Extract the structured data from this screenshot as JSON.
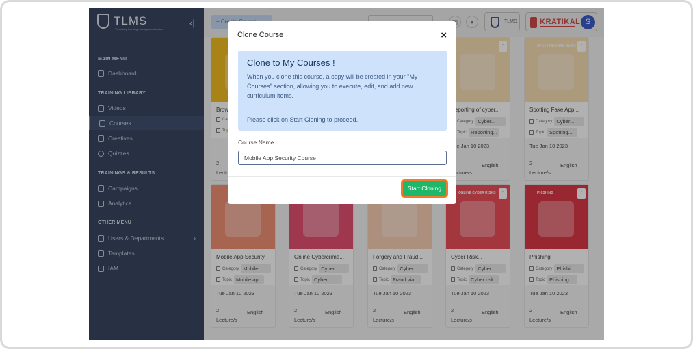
{
  "app": {
    "logo_text": "TLMS",
    "logo_sub": "Threatcop learning management system"
  },
  "sidebar": {
    "sections": [
      {
        "heading": "MAIN MENU",
        "items": [
          {
            "label": "Dashboard",
            "icon": "home-icon"
          }
        ]
      },
      {
        "heading": "TRAINING LIBRARY",
        "items": [
          {
            "label": "Videos",
            "icon": "video-icon"
          },
          {
            "label": "Courses",
            "icon": "book-icon",
            "active": true
          },
          {
            "label": "Creatives",
            "icon": "image-icon"
          },
          {
            "label": "Quizzes",
            "icon": "help-circle-icon"
          }
        ]
      },
      {
        "heading": "TRAININGS & RESULTS",
        "items": [
          {
            "label": "Campaigns",
            "icon": "megaphone-icon"
          },
          {
            "label": "Analytics",
            "icon": "chart-icon"
          }
        ]
      },
      {
        "heading": "OTHER MENU",
        "items": [
          {
            "label": "Users & Departments",
            "icon": "users-icon"
          },
          {
            "label": "Templates",
            "icon": "megaphone-icon"
          },
          {
            "label": "IAM",
            "icon": "key-icon"
          }
        ]
      }
    ]
  },
  "topbar": {
    "create_label": "+ Create Course",
    "tlms_label": "TLMS",
    "brand": "KRATIKAL",
    "avatar_initial": "S"
  },
  "cards": [
    {
      "title": "Brow...",
      "category": "",
      "topic": "",
      "date": "",
      "lectures": "2",
      "lectures_unit": "Lecture/s",
      "language": "",
      "color": "#f0b400"
    },
    {
      "title": "Reporting of cyber...",
      "category": "Cyber...",
      "topic": "Reporting...",
      "date": "Tue Jan 10 2023",
      "lectures": "2",
      "lectures_unit": "Lecture/s",
      "language": "English",
      "color": "#f7d9a8"
    },
    {
      "title": "Spotting Fake App...",
      "category": "Cyber...",
      "topic": "Spotting...",
      "date": "Tue Jan 10 2023",
      "lectures": "2",
      "lectures_unit": "Lecture/s",
      "language": "English",
      "color": "#f7d9a8",
      "tag": "SPOTTING FAKE NEWS"
    },
    {
      "title": "Mobile App Security",
      "category": "Mobile...",
      "topic": "Mobile ap...",
      "date": "Tue Jan 10 2023",
      "lectures": "2",
      "lectures_unit": "Lecture/s",
      "language": "English",
      "color": "#ef7f60"
    },
    {
      "title": "Online Cybercrime...",
      "category": "Cyber...",
      "topic": "Cyber...",
      "date": "Tue Jan 10 2023",
      "lectures": "2",
      "lectures_unit": "Lecture/s",
      "language": "English",
      "color": "#e2365b"
    },
    {
      "title": "Forgery and Fraud...",
      "category": "Cyber...",
      "topic": "Fraud via...",
      "date": "Tue Jan 10 2023",
      "lectures": "2",
      "lectures_unit": "Lecture/s",
      "language": "English",
      "color": "#f7c8a8"
    },
    {
      "title": "Cyber Risk...",
      "category": "Cyber...",
      "topic": "Cyber risk...",
      "date": "Tue Jan 10 2023",
      "lectures": "2",
      "lectures_unit": "Lecture/s",
      "language": "English",
      "color": "#e8353f",
      "tag": "ONLINE CYBER RISKS"
    },
    {
      "title": "Phishing",
      "category": "Phishi...",
      "topic": "Phishing",
      "date": "Tue Jan 10 2023",
      "lectures": "2",
      "lectures_unit": "Lecture/s",
      "language": "English",
      "color": "#d7192a",
      "tag": "PHISHING"
    }
  ],
  "card_labels": {
    "category": "Category",
    "topic": "Topic"
  },
  "modal": {
    "title": "Clone Course",
    "close": "×",
    "info_heading": "Clone to My Courses !",
    "info_text": "When you clone this course, a copy will be created in your \"My Courses\" section, allowing you to execute, edit, and add new curriculum items.",
    "info_hint": "Please click on Start Cloning to proceed.",
    "field_label": "Course Name",
    "field_value": "Mobile App Security Course",
    "submit_label": "Start Cloning"
  },
  "colors": {
    "sidebar": "#1b2a4a",
    "accent_green": "#1fb86a",
    "highlight": "#f07a2d",
    "info_bg": "#cfe2fb"
  }
}
